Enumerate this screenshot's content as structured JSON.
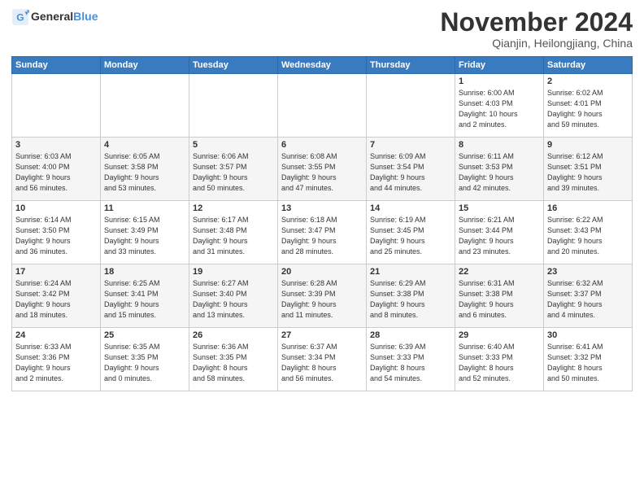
{
  "header": {
    "logo_general": "General",
    "logo_blue": "Blue",
    "title": "November 2024",
    "location": "Qianjin, Heilongjiang, China"
  },
  "days_of_week": [
    "Sunday",
    "Monday",
    "Tuesday",
    "Wednesday",
    "Thursday",
    "Friday",
    "Saturday"
  ],
  "weeks": [
    [
      {
        "day": "",
        "info": ""
      },
      {
        "day": "",
        "info": ""
      },
      {
        "day": "",
        "info": ""
      },
      {
        "day": "",
        "info": ""
      },
      {
        "day": "",
        "info": ""
      },
      {
        "day": "1",
        "info": "Sunrise: 6:00 AM\nSunset: 4:03 PM\nDaylight: 10 hours\nand 2 minutes."
      },
      {
        "day": "2",
        "info": "Sunrise: 6:02 AM\nSunset: 4:01 PM\nDaylight: 9 hours\nand 59 minutes."
      }
    ],
    [
      {
        "day": "3",
        "info": "Sunrise: 6:03 AM\nSunset: 4:00 PM\nDaylight: 9 hours\nand 56 minutes."
      },
      {
        "day": "4",
        "info": "Sunrise: 6:05 AM\nSunset: 3:58 PM\nDaylight: 9 hours\nand 53 minutes."
      },
      {
        "day": "5",
        "info": "Sunrise: 6:06 AM\nSunset: 3:57 PM\nDaylight: 9 hours\nand 50 minutes."
      },
      {
        "day": "6",
        "info": "Sunrise: 6:08 AM\nSunset: 3:55 PM\nDaylight: 9 hours\nand 47 minutes."
      },
      {
        "day": "7",
        "info": "Sunrise: 6:09 AM\nSunset: 3:54 PM\nDaylight: 9 hours\nand 44 minutes."
      },
      {
        "day": "8",
        "info": "Sunrise: 6:11 AM\nSunset: 3:53 PM\nDaylight: 9 hours\nand 42 minutes."
      },
      {
        "day": "9",
        "info": "Sunrise: 6:12 AM\nSunset: 3:51 PM\nDaylight: 9 hours\nand 39 minutes."
      }
    ],
    [
      {
        "day": "10",
        "info": "Sunrise: 6:14 AM\nSunset: 3:50 PM\nDaylight: 9 hours\nand 36 minutes."
      },
      {
        "day": "11",
        "info": "Sunrise: 6:15 AM\nSunset: 3:49 PM\nDaylight: 9 hours\nand 33 minutes."
      },
      {
        "day": "12",
        "info": "Sunrise: 6:17 AM\nSunset: 3:48 PM\nDaylight: 9 hours\nand 31 minutes."
      },
      {
        "day": "13",
        "info": "Sunrise: 6:18 AM\nSunset: 3:47 PM\nDaylight: 9 hours\nand 28 minutes."
      },
      {
        "day": "14",
        "info": "Sunrise: 6:19 AM\nSunset: 3:45 PM\nDaylight: 9 hours\nand 25 minutes."
      },
      {
        "day": "15",
        "info": "Sunrise: 6:21 AM\nSunset: 3:44 PM\nDaylight: 9 hours\nand 23 minutes."
      },
      {
        "day": "16",
        "info": "Sunrise: 6:22 AM\nSunset: 3:43 PM\nDaylight: 9 hours\nand 20 minutes."
      }
    ],
    [
      {
        "day": "17",
        "info": "Sunrise: 6:24 AM\nSunset: 3:42 PM\nDaylight: 9 hours\nand 18 minutes."
      },
      {
        "day": "18",
        "info": "Sunrise: 6:25 AM\nSunset: 3:41 PM\nDaylight: 9 hours\nand 15 minutes."
      },
      {
        "day": "19",
        "info": "Sunrise: 6:27 AM\nSunset: 3:40 PM\nDaylight: 9 hours\nand 13 minutes."
      },
      {
        "day": "20",
        "info": "Sunrise: 6:28 AM\nSunset: 3:39 PM\nDaylight: 9 hours\nand 11 minutes."
      },
      {
        "day": "21",
        "info": "Sunrise: 6:29 AM\nSunset: 3:38 PM\nDaylight: 9 hours\nand 8 minutes."
      },
      {
        "day": "22",
        "info": "Sunrise: 6:31 AM\nSunset: 3:38 PM\nDaylight: 9 hours\nand 6 minutes."
      },
      {
        "day": "23",
        "info": "Sunrise: 6:32 AM\nSunset: 3:37 PM\nDaylight: 9 hours\nand 4 minutes."
      }
    ],
    [
      {
        "day": "24",
        "info": "Sunrise: 6:33 AM\nSunset: 3:36 PM\nDaylight: 9 hours\nand 2 minutes."
      },
      {
        "day": "25",
        "info": "Sunrise: 6:35 AM\nSunset: 3:35 PM\nDaylight: 9 hours\nand 0 minutes."
      },
      {
        "day": "26",
        "info": "Sunrise: 6:36 AM\nSunset: 3:35 PM\nDaylight: 8 hours\nand 58 minutes."
      },
      {
        "day": "27",
        "info": "Sunrise: 6:37 AM\nSunset: 3:34 PM\nDaylight: 8 hours\nand 56 minutes."
      },
      {
        "day": "28",
        "info": "Sunrise: 6:39 AM\nSunset: 3:33 PM\nDaylight: 8 hours\nand 54 minutes."
      },
      {
        "day": "29",
        "info": "Sunrise: 6:40 AM\nSunset: 3:33 PM\nDaylight: 8 hours\nand 52 minutes."
      },
      {
        "day": "30",
        "info": "Sunrise: 6:41 AM\nSunset: 3:32 PM\nDaylight: 8 hours\nand 50 minutes."
      }
    ]
  ]
}
